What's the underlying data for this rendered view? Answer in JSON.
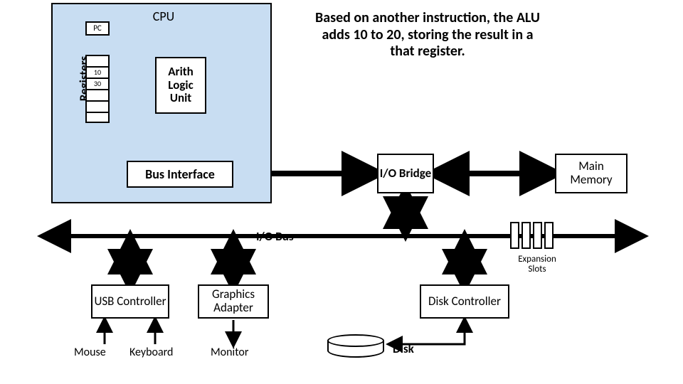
{
  "cpu": {
    "title": "CPU",
    "pc_label": "PC",
    "registers_label": "Registers",
    "reg_values": [
      "",
      "10",
      "30",
      "",
      "",
      ""
    ],
    "alu_label": "Arith Logic Unit",
    "bus_interface": "Bus Interface"
  },
  "caption": "Based on another instruction, the ALU adds 10 to 20, storing the result in a that register.",
  "io_bridge": "I/O Bridge",
  "main_memory": "Main Memory",
  "io_bus": "I/O Bus",
  "expansion_slots": "Expansion Slots",
  "usb_controller": "USB Controller",
  "graphics_adapter": "Graphics Adapter",
  "disk_controller": "Disk Controller",
  "mouse": "Mouse",
  "keyboard": "Keyboard",
  "monitor": "Monitor",
  "disk": "Disk"
}
